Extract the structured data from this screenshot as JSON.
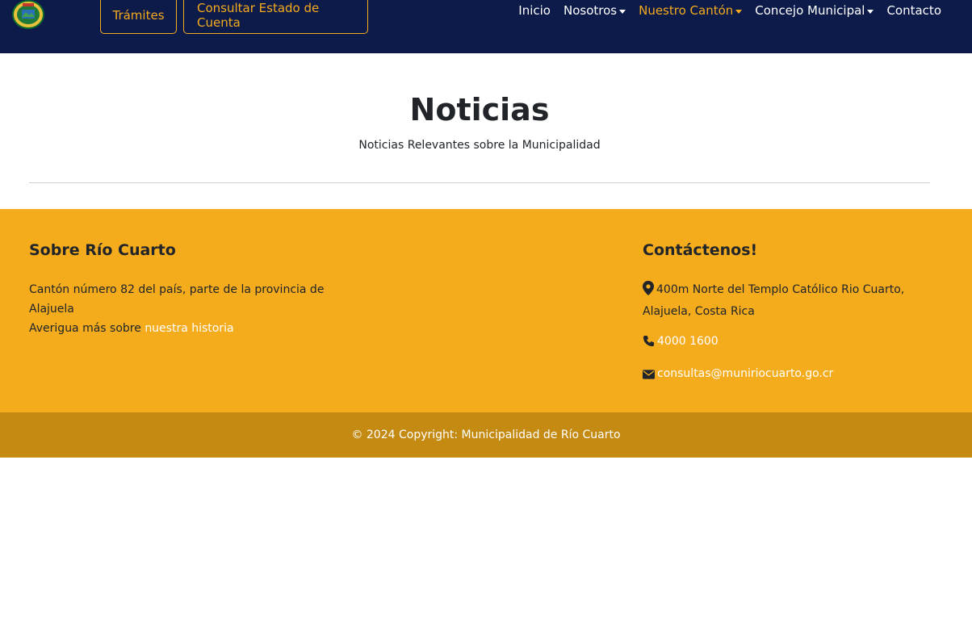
{
  "navbar": {
    "logo_icon": "municipal-seal-logo",
    "buttons": {
      "tramites": "Trámites",
      "estado_cuenta": "Consultar Estado de Cuenta"
    },
    "links": {
      "inicio": "Inicio",
      "nosotros": "Nosotros",
      "nuestro_canton": "Nuestro Cantón",
      "concejo_municipal": "Concejo Municipal",
      "contacto": "Contacto"
    },
    "colors": {
      "background": "#0d1b4b",
      "accent": "#f4ab1c"
    }
  },
  "hero": {
    "title": "Noticias",
    "subtitle": "Noticias Relevantes sobre la Municipalidad"
  },
  "footer": {
    "about": {
      "heading": "Sobre Río Cuarto",
      "text": "Cantón número 82 del país, parte de la provincia de Alajuela",
      "more_prefix": "Averigua más sobre ",
      "more_link": "nuestra historia"
    },
    "contact": {
      "heading": "Contáctenos!",
      "address": "400m Norte del Templo Católico Rio Cuarto, Alajuela, Costa Rica",
      "phone": "4000 1600",
      "email": "consultas@muniriocuarto.go.cr",
      "icons": [
        "map-marker-icon",
        "phone-icon",
        "envelope-icon"
      ]
    },
    "copyright": "© 2024 Copyright: Municipalidad de Río Cuarto",
    "colors": {
      "main": "#f4ab1c",
      "bottom": "#c48a12"
    }
  }
}
